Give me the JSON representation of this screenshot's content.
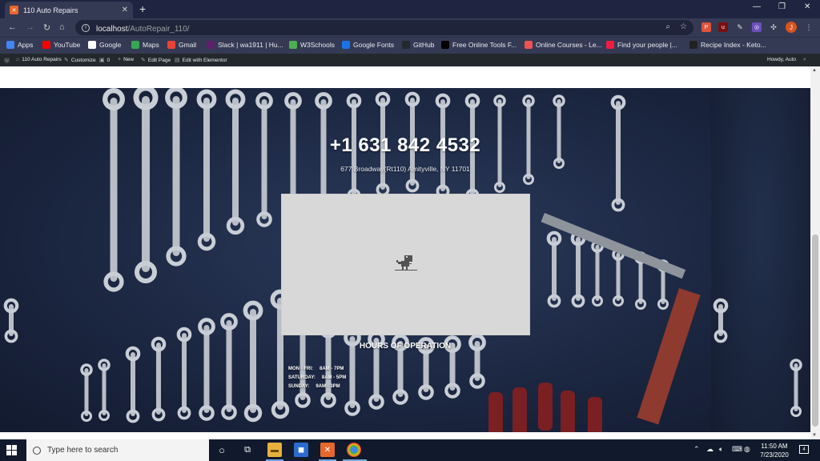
{
  "browser": {
    "tab_title": "110 Auto Repairs",
    "url_host": "localhost",
    "url_path": "/AutoRepair_110/",
    "profile_initial": "J"
  },
  "bookmarks": [
    {
      "label": "Apps",
      "icon": "apps-grid-icon",
      "color": "#4285f4"
    },
    {
      "label": "YouTube",
      "icon": "youtube-icon",
      "color": "#ff0000"
    },
    {
      "label": "Google",
      "icon": "google-icon",
      "color": "#ffffff"
    },
    {
      "label": "Maps",
      "icon": "maps-icon",
      "color": "#34a853"
    },
    {
      "label": "Gmail",
      "icon": "gmail-icon",
      "color": "#ea4335"
    },
    {
      "label": "Slack | wa1911 | Hu...",
      "icon": "slack-icon",
      "color": "#611f69"
    },
    {
      "label": "W3Schools",
      "icon": "w3schools-icon",
      "color": "#4caf50"
    },
    {
      "label": "Google Fonts",
      "icon": "google-fonts-icon",
      "color": "#1a73e8"
    },
    {
      "label": "GitHub",
      "icon": "github-icon",
      "color": "#24292e"
    },
    {
      "label": "Free Online Tools F...",
      "icon": "ff-icon",
      "color": "#000000"
    },
    {
      "label": "Online Courses - Le...",
      "icon": "udemy-icon",
      "color": "#ec5252"
    },
    {
      "label": "Find your people |...",
      "icon": "meetup-icon",
      "color": "#ed1c40"
    },
    {
      "label": "Recipe Index - Keto...",
      "icon": "recipe-icon",
      "color": "#222222"
    }
  ],
  "wp_admin": {
    "site_name": "110 Auto Repairs",
    "customize": "Customize",
    "comments_count": "0",
    "new": "New",
    "edit_page": "Edit Page",
    "edit_elementor": "Edit with Elementor",
    "howdy": "Howdy, Auto"
  },
  "hero": {
    "phone": "+1 631 842 4532",
    "address": "677 Broadway(Rt110) Amityville, NY 11701",
    "hours_title": "HOURS OF OPERATION",
    "hours": [
      {
        "days": "MON - FRI:",
        "time": "8AM - 7PM"
      },
      {
        "days": "SATURDAY:",
        "time": "8AM - 5PM"
      },
      {
        "days": "SUNDAY:",
        "time": "9AM - 3PM"
      }
    ]
  },
  "taskbar": {
    "search_placeholder": "Type here to search",
    "time": "11:50 AM",
    "date": "7/23/2020",
    "notification_count": "4"
  }
}
